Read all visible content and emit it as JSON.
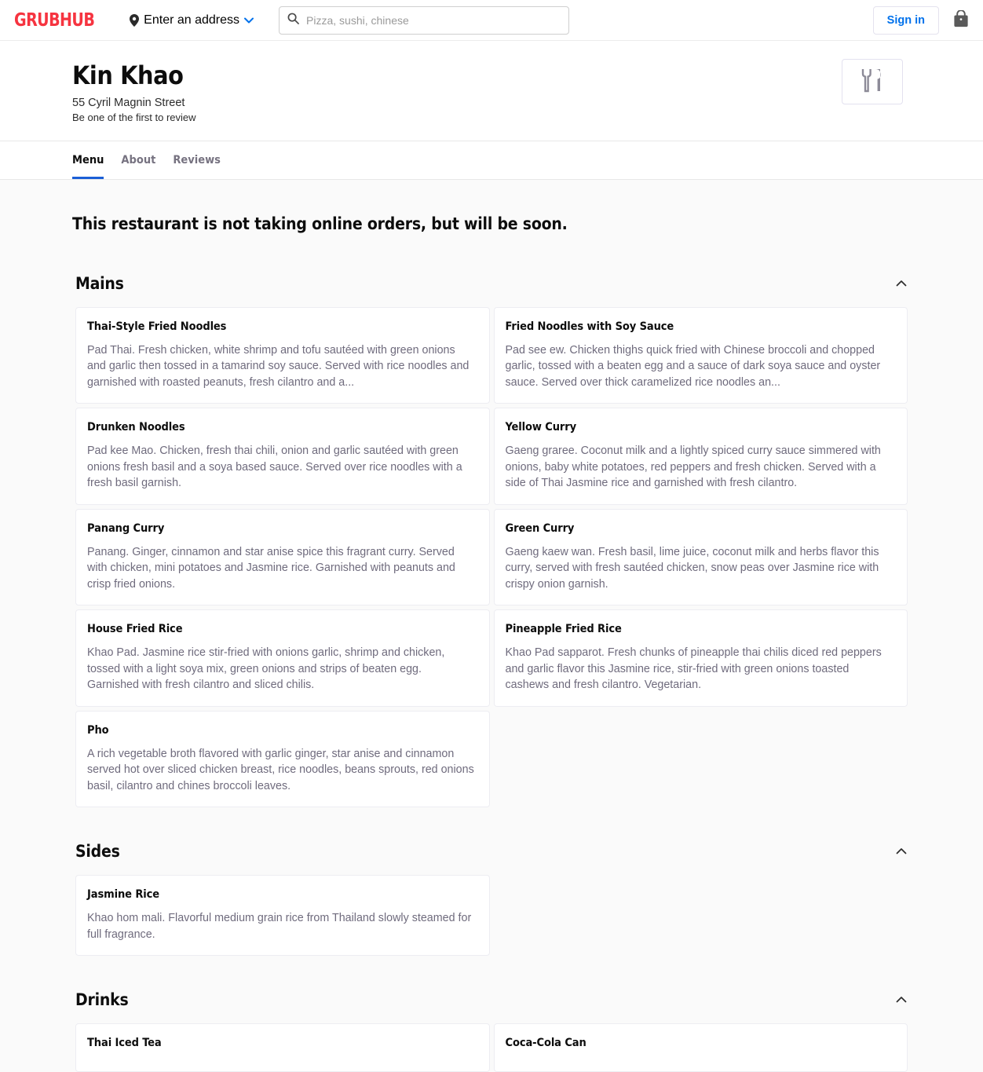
{
  "header": {
    "logo": "GRUBHUB",
    "address_label": "Enter an address",
    "search_placeholder": "Pizza, sushi, chinese",
    "search_value": "",
    "signin_label": "Sign in",
    "icons": {
      "pin": "location-pin-icon",
      "chevron": "chevron-down-icon",
      "search": "search-icon",
      "bag": "shopping-bag-icon"
    },
    "colors": {
      "brand": "#f63440",
      "link": "#0071eb",
      "accent": "#1b5fd6"
    }
  },
  "restaurant": {
    "name": "Kin Khao",
    "address": "55 Cyril Magnin Street",
    "review_text": "Be one of the first to review",
    "logo_placeholder_icon": "fork-and-knife-icon"
  },
  "tabs": [
    {
      "label": "Menu",
      "active": true
    },
    {
      "label": "About",
      "active": false
    },
    {
      "label": "Reviews",
      "active": false
    }
  ],
  "notice": "This restaurant is not taking online orders, but will be soon.",
  "sections": [
    {
      "title": "Mains",
      "collapse_icon": "chevron-up-icon",
      "items": [
        {
          "name": "Thai-Style Fried Noodles",
          "description": "Pad Thai. Fresh chicken, white shrimp and tofu sautéed with green onions and garlic then tossed in a tamarind soy sauce. Served with rice noodles and garnished with roasted peanuts, fresh cilantro and a..."
        },
        {
          "name": "Fried Noodles with Soy Sauce",
          "description": "Pad see ew. Chicken thighs quick fried with Chinese broccoli and chopped garlic, tossed with a beaten egg and a sauce of dark soya sauce and oyster sauce. Served over thick caramelized rice noodles an..."
        },
        {
          "name": "Drunken Noodles",
          "description": "Pad kee Mao. Chicken, fresh thai chili, onion and garlic sautéed with green onions fresh basil and a soya based sauce. Served over rice noodles with a fresh basil garnish."
        },
        {
          "name": "Yellow Curry",
          "description": "Gaeng graree. Coconut milk and a lightly spiced curry sauce simmered with onions, baby white potatoes, red peppers and fresh chicken. Served with a side of Thai Jasmine rice and garnished with fresh cilantro."
        },
        {
          "name": "Panang Curry",
          "description": "Panang. Ginger, cinnamon and star anise spice this fragrant curry. Served with chicken, mini potatoes and Jasmine rice. Garnished with peanuts and crisp fried onions."
        },
        {
          "name": "Green Curry",
          "description": "Gaeng kaew wan. Fresh basil, lime juice, coconut milk and herbs flavor this curry, served with fresh sautéed chicken, snow peas over Jasmine rice with crispy onion garnish."
        },
        {
          "name": "House Fried Rice",
          "description": "Khao Pad. Jasmine rice stir-fried with onions garlic, shrimp and chicken, tossed with a light soya mix, green onions and strips of beaten egg. Garnished with fresh cilantro and sliced chilis."
        },
        {
          "name": "Pineapple Fried Rice",
          "description": "Khao Pad sapparot. Fresh chunks of pineapple thai chilis diced red peppers and garlic flavor this Jasmine rice, stir-fried with green onions toasted cashews and fresh cilantro. Vegetarian."
        },
        {
          "name": "Pho",
          "description": "A rich vegetable broth flavored with garlic ginger, star anise and cinnamon served hot over sliced chicken breast, rice noodles, beans sprouts, red onions basil, cilantro and chines broccoli leaves."
        }
      ]
    },
    {
      "title": "Sides",
      "collapse_icon": "chevron-up-icon",
      "items": [
        {
          "name": "Jasmine Rice",
          "description": "Khao hom mali. Flavorful medium grain rice from Thailand slowly steamed for full fragrance."
        }
      ]
    },
    {
      "title": "Drinks",
      "collapse_icon": "chevron-up-icon",
      "items": [
        {
          "name": "Thai Iced Tea",
          "description": ""
        },
        {
          "name": "Coca-Cola Can",
          "description": ""
        }
      ]
    }
  ]
}
